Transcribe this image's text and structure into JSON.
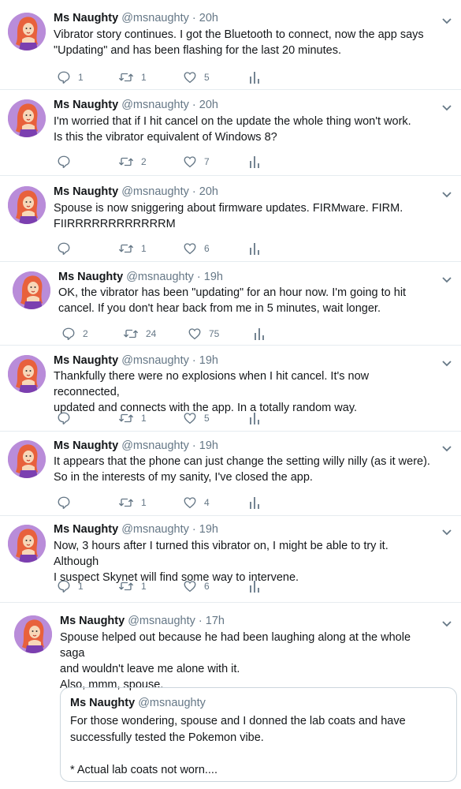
{
  "user": {
    "name": "Ms Naughty",
    "handle": "@msnaughty"
  },
  "colors": {
    "avatar_bg": "#b98cd9",
    "hair": "#e8613c",
    "icon": "#657786",
    "text": "#14171a"
  },
  "tweets": [
    {
      "time": "20h",
      "lines": [
        "Vibrator story continues. I got the Bluetooth to connect, now the app says",
        "\"Updating\" and has been flashing for the last 20 minutes."
      ],
      "reply": "1",
      "retweet": "1",
      "like": "5"
    },
    {
      "time": "20h",
      "lines": [
        "I'm worried that if I hit cancel on the update the whole thing won't work.",
        "Is this the vibrator equivalent of Windows 8?"
      ],
      "reply": "",
      "retweet": "2",
      "like": "7"
    },
    {
      "time": "20h",
      "lines": [
        "Spouse is now sniggering about firmware updates. FIRMware. FIRM.",
        "FIIRRRRRRRRRRRRM"
      ],
      "reply": "",
      "retweet": "1",
      "like": "6"
    },
    {
      "time": "19h",
      "lines": [
        "OK, the vibrator has been \"updating\" for an hour now. I'm going to hit",
        "cancel. If you don't hear back from me in 5 minutes, wait longer."
      ],
      "reply": "2",
      "retweet": "24",
      "like": "75"
    },
    {
      "time": "19h",
      "lines": [
        "Thankfully there were no explosions when I hit cancel. It's now reconnected,",
        "updated and connects with the app. In a totally random way."
      ],
      "reply": "",
      "retweet": "1",
      "like": "5"
    },
    {
      "time": "19h",
      "lines": [
        "It appears that the phone can just change the setting willy nilly (as it were).",
        "So in the interests of my sanity, I've closed the app."
      ],
      "reply": "",
      "retweet": "1",
      "like": "4"
    },
    {
      "time": "19h",
      "lines": [
        "Now, 3 hours after I turned this vibrator on, I might be able to try it. Although",
        "I suspect Skynet will find some way to intervene."
      ],
      "reply": "1",
      "retweet": "1",
      "like": "6"
    },
    {
      "time": "17h",
      "lines": [
        "Spouse helped out because he had been laughing along at the whole saga",
        "and wouldn't leave me alone with it.",
        "Also, mmm, spouse."
      ],
      "reply": "",
      "retweet": "",
      "like": ""
    }
  ],
  "quoted": {
    "name": "Ms Naughty",
    "handle": "@msnaughty",
    "lines": [
      "For those wondering, spouse and I donned the lab coats and have",
      "successfully tested the Pokemon vibe.",
      "",
      "* Actual lab coats not worn...."
    ]
  }
}
